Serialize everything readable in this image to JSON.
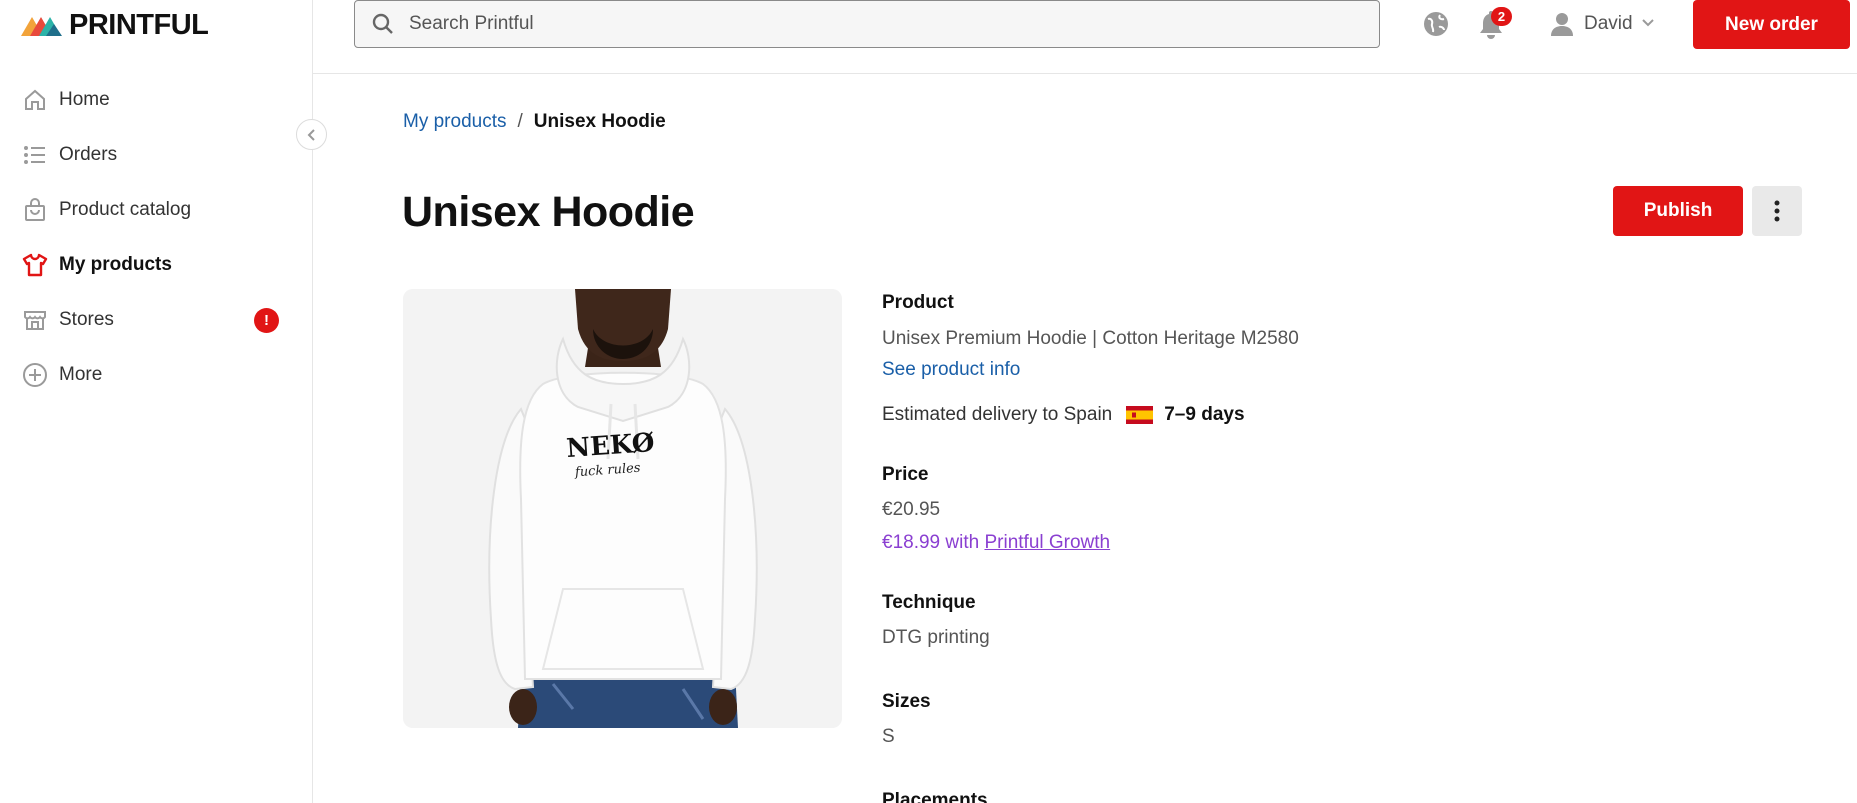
{
  "app": {
    "logo_text": "PRINTFUL"
  },
  "sidebar": {
    "items": [
      {
        "label": "Home",
        "icon": "home-icon",
        "active": false
      },
      {
        "label": "Orders",
        "icon": "list-icon",
        "active": false
      },
      {
        "label": "Product catalog",
        "icon": "shopping-bag-icon",
        "active": false
      },
      {
        "label": "My products",
        "icon": "tshirt-icon",
        "active": true
      },
      {
        "label": "Stores",
        "icon": "store-icon",
        "active": false,
        "alert": "!"
      },
      {
        "label": "More",
        "icon": "plus-circle-icon",
        "active": false
      }
    ]
  },
  "topbar": {
    "search_placeholder": "Search Printful",
    "notifications_count": "2",
    "user_name": "David",
    "new_order_label": "New order"
  },
  "breadcrumb": {
    "parent": "My products",
    "separator": "/",
    "current": "Unisex Hoodie"
  },
  "page": {
    "title": "Unisex Hoodie",
    "publish_label": "Publish"
  },
  "image": {
    "print_text": "NEKØ",
    "print_subtext": "fuck rules"
  },
  "details": {
    "product_heading": "Product",
    "product_name": "Unisex Premium Hoodie | Cotton Heritage M2580",
    "product_info_link": "See product info",
    "delivery_text": "Estimated delivery to Spain",
    "delivery_days": "7–9 days",
    "price_heading": "Price",
    "price": "€20.95",
    "growth_price_prefix": "€18.99 with",
    "growth_link": "Printful Growth",
    "technique_heading": "Technique",
    "technique": "DTG printing",
    "sizes_heading": "Sizes",
    "sizes": "S",
    "placements_heading": "Placements"
  },
  "colors": {
    "brand_red": "#e11515",
    "link_blue": "#1a5fa8",
    "growth_purple": "#8a3fd1"
  }
}
